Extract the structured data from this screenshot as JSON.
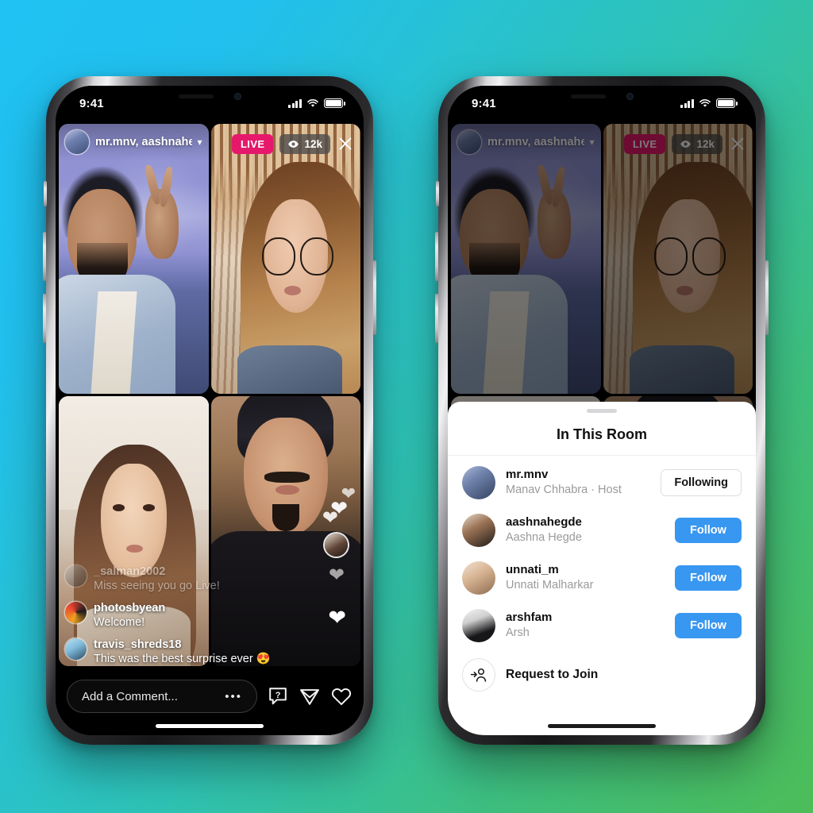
{
  "background": {
    "from": "#1fc2f2",
    "to": "#4dbd58"
  },
  "accents": {
    "live": "#e6186c",
    "follow_button": "#3897f0",
    "following_text": "#141414"
  },
  "status_bar": {
    "time": "9:41",
    "signal_icon": "cellular-bars-icon",
    "wifi_icon": "wifi-icon",
    "battery_icon": "battery-icon"
  },
  "left_phone": {
    "header": {
      "avatar": "host-avatar",
      "participants_label": "mr.mnv, aashnahe...",
      "chevron_icon": "chevron-down-icon"
    },
    "badges": {
      "live_label": "LIVE",
      "viewers_label": "12k",
      "eye_icon": "eye-icon",
      "close_icon": "close-icon"
    },
    "tiles": [
      {
        "name": "mr.mnv"
      },
      {
        "name": "aashnahegde"
      },
      {
        "name": "unnati_m"
      },
      {
        "name": "arshfam"
      }
    ],
    "hearts": {
      "reaction_icon": "heart-icon",
      "reactor_avatar": "reactor-avatar"
    },
    "comments": [
      {
        "user": "_salman2002",
        "text": "Miss seeing you go Live!",
        "faded": true
      },
      {
        "user": "photosbyean",
        "text": "Welcome!",
        "faded": false
      },
      {
        "user": "travis_shreds18",
        "text": "This was the best surprise ever 😍",
        "faded": false
      }
    ],
    "bottom_bar": {
      "comment_placeholder": "Add a Comment...",
      "more_icon": "ellipsis-icon",
      "question_icon": "question-bubble-icon",
      "share_icon": "paper-plane-icon",
      "like_icon": "heart-outline-icon"
    }
  },
  "right_phone": {
    "sheet": {
      "grabber_icon": "drag-handle-icon",
      "title": "In This Room",
      "rows": [
        {
          "username": "mr.mnv",
          "fullname": "Manav Chhabra · Host",
          "action": "Following",
          "action_style": "following"
        },
        {
          "username": "aashnahegde",
          "fullname": "Aashna Hegde",
          "action": "Follow",
          "action_style": "follow"
        },
        {
          "username": "unnati_m",
          "fullname": "Unnati Malharkar",
          "action": "Follow",
          "action_style": "follow"
        },
        {
          "username": "arshfam",
          "fullname": "Arsh",
          "action": "Follow",
          "action_style": "follow"
        }
      ],
      "request_row": {
        "icon": "person-add-icon",
        "label": "Request to Join"
      }
    }
  }
}
